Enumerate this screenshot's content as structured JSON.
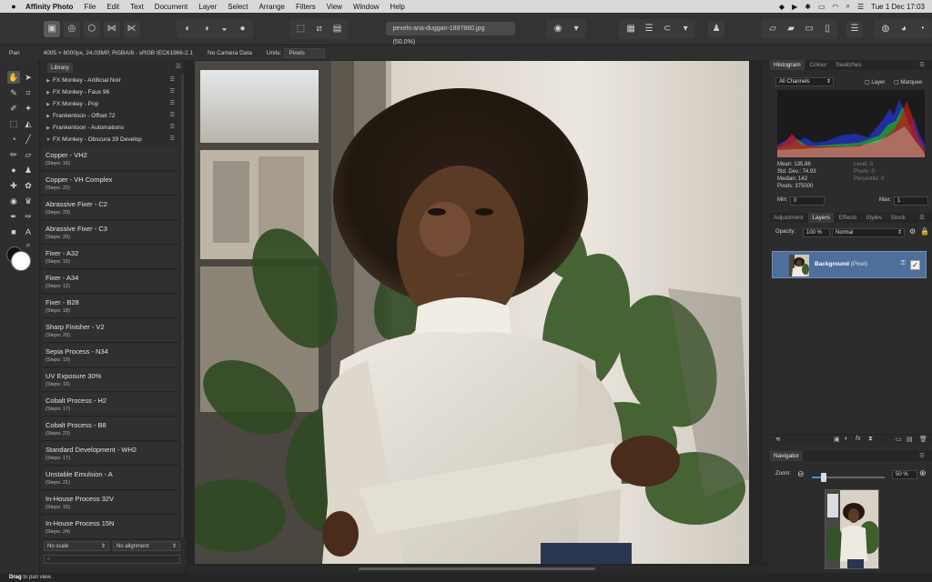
{
  "menubar": {
    "app": "Affinity Photo",
    "items": [
      "File",
      "Edit",
      "Text",
      "Document",
      "Layer",
      "Select",
      "Arrange",
      "Filters",
      "View",
      "Window",
      "Help"
    ],
    "clock": "Tue 1 Dec  17:03"
  },
  "toolbar": {
    "document_tab": "pexels-ana-duggan-1897860.jpg (50.0%)"
  },
  "context_bar": {
    "tool": "Pan",
    "doc_info": "4005 × 6000px, 24.03MP, RGBA/8 - sRGB IEC61966-2.1",
    "camera": "No Camera Data",
    "units_label": "Units:",
    "units_value": "Pixels"
  },
  "library": {
    "tab": "Library",
    "groups": [
      {
        "label": "FX Monkey - Artificial Noir",
        "open": false
      },
      {
        "label": "FX Monkey - Faux 96",
        "open": false
      },
      {
        "label": "FX Monkey - Pop",
        "open": false
      },
      {
        "label": "Frankentoon - Offset 72",
        "open": false
      },
      {
        "label": "Frankentoon - Automations",
        "open": false
      },
      {
        "label": "FX Monkey - Obscura 39 Develop",
        "open": true
      }
    ],
    "macros": [
      {
        "title": "Copper - VH2",
        "steps": "(Steps: 16)"
      },
      {
        "title": "Copper - VH Complex",
        "steps": "(Steps: 22)"
      },
      {
        "title": "Abrassive Fixer - C2",
        "steps": "(Steps: 23)"
      },
      {
        "title": "Abrassive Fixer - C3",
        "steps": "(Steps: 20)"
      },
      {
        "title": "Fixer - A32",
        "steps": "(Steps: 15)"
      },
      {
        "title": "Fixer - A34",
        "steps": "(Steps: 12)"
      },
      {
        "title": "Fixer - B28",
        "steps": "(Steps: 18)"
      },
      {
        "title": "Sharp Finisher - V2",
        "steps": "(Steps: 20)"
      },
      {
        "title": "Sepia Process - N34",
        "steps": "(Steps: 19)"
      },
      {
        "title": "UV Exposure 30%",
        "steps": "(Steps: 16)"
      },
      {
        "title": "Cobalt Process - H2",
        "steps": "(Steps: 17)"
      },
      {
        "title": "Cobalt Process - B8",
        "steps": "(Steps: 23)"
      },
      {
        "title": "Standard Development - WH2",
        "steps": "(Steps: 17)"
      },
      {
        "title": "Unstable Emulsion - A",
        "steps": "(Steps: 21)"
      },
      {
        "title": "In-House Process 32V",
        "steps": "(Steps: 15)"
      },
      {
        "title": "In-House Process 15N",
        "steps": "(Steps: 24)"
      }
    ],
    "scale_select": "No scale",
    "align_select": "No alignment"
  },
  "histogram": {
    "tabs": [
      "Histogram",
      "Colour",
      "Swatches"
    ],
    "channel": "All Channels",
    "layer_label": "Layer",
    "marquee_label": "Marquee",
    "stats": [
      {
        "k": "Mean:",
        "v": "135.86"
      },
      {
        "k": "Std. Dev.:",
        "v": "74.93"
      },
      {
        "k": "Median:",
        "v": "142"
      },
      {
        "k": "Pixels:",
        "v": "375000"
      }
    ],
    "stats_right": [
      {
        "k": "Level:",
        "v": "0"
      },
      {
        "k": "Pixels:",
        "v": "0"
      },
      {
        "k": "Percentile:",
        "v": "0"
      }
    ],
    "min_label": "Min:",
    "min_value": "0",
    "max_label": "Max:",
    "max_value": "1"
  },
  "layers": {
    "tabs": [
      "Adjustment",
      "Layers",
      "Effects",
      "Styles",
      "Stock"
    ],
    "opacity_label": "Opacity:",
    "opacity_value": "100 %",
    "blend_mode": "Normal",
    "layer_name": "Background",
    "layer_kind": "(Pixel)"
  },
  "navigator": {
    "tab": "Navigator",
    "zoom_label": "Zoom:",
    "zoom_value": "50 %",
    "zoom_level": 0.5
  },
  "status": {
    "hint_bold": "Drag",
    "hint_rest": " to pan view."
  }
}
